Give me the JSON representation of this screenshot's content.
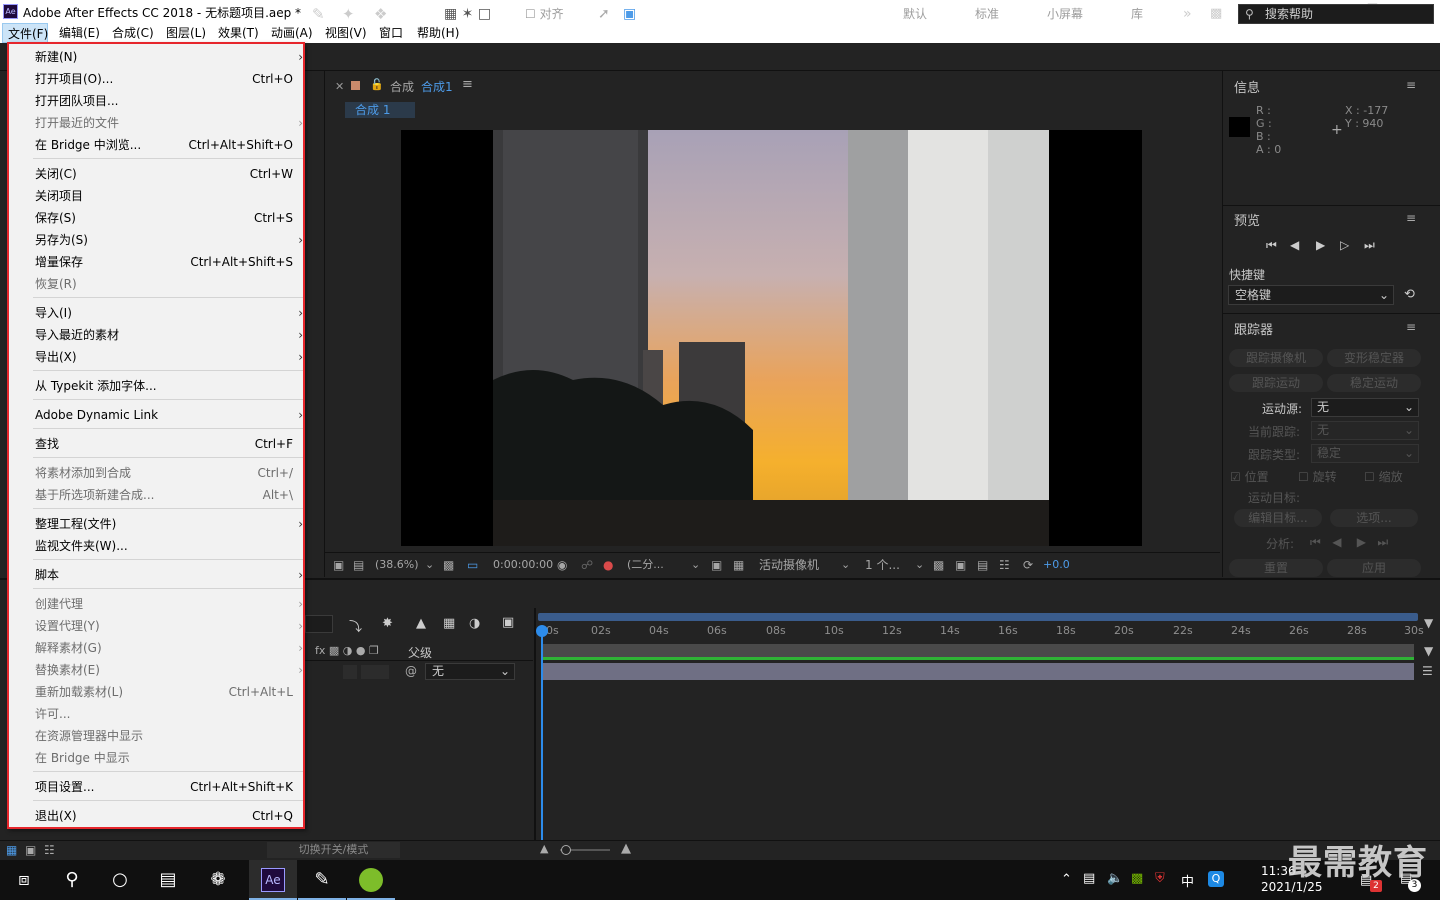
{
  "window": {
    "title": "Adobe After Effects CC 2018 - 无标题项目.aep *",
    "app_icon": "Ae"
  },
  "menubar": [
    "文件(F)",
    "编辑(E)",
    "合成(C)",
    "图层(L)",
    "效果(T)",
    "动画(A)",
    "视图(V)",
    "窗口",
    "帮助(H)"
  ],
  "toolbar": {
    "snap_label": "对齐",
    "workspaces": [
      "默认",
      "标准",
      "小屏幕",
      "库"
    ],
    "more": "»",
    "help_placeholder": "搜索帮助"
  },
  "file_menu": [
    {
      "label": "新建(N)",
      "shortcut": "",
      "submenu": true,
      "disabled": false
    },
    {
      "label": "打开项目(O)...",
      "shortcut": "Ctrl+O",
      "submenu": false,
      "disabled": false
    },
    {
      "label": "打开团队项目...",
      "shortcut": "",
      "submenu": false,
      "disabled": false
    },
    {
      "label": "打开最近的文件",
      "shortcut": "",
      "submenu": true,
      "disabled": true
    },
    {
      "label": "在 Bridge 中浏览...",
      "shortcut": "Ctrl+Alt+Shift+O",
      "submenu": false,
      "disabled": false
    },
    {
      "label": "关闭(C)",
      "shortcut": "Ctrl+W",
      "submenu": false,
      "disabled": false
    },
    {
      "label": "关闭项目",
      "shortcut": "",
      "submenu": false,
      "disabled": false
    },
    {
      "label": "保存(S)",
      "shortcut": "Ctrl+S",
      "submenu": false,
      "disabled": false
    },
    {
      "label": "另存为(S)",
      "shortcut": "",
      "submenu": true,
      "disabled": false
    },
    {
      "label": "增量保存",
      "shortcut": "Ctrl+Alt+Shift+S",
      "submenu": false,
      "disabled": false
    },
    {
      "label": "恢复(R)",
      "shortcut": "",
      "submenu": false,
      "disabled": true
    },
    {
      "label": "导入(I)",
      "shortcut": "",
      "submenu": true,
      "disabled": false
    },
    {
      "label": "导入最近的素材",
      "shortcut": "",
      "submenu": true,
      "disabled": false
    },
    {
      "label": "导出(X)",
      "shortcut": "",
      "submenu": true,
      "disabled": false
    },
    {
      "label": "从 Typekit 添加字体...",
      "shortcut": "",
      "submenu": false,
      "disabled": false
    },
    {
      "label": "Adobe Dynamic Link",
      "shortcut": "",
      "submenu": true,
      "disabled": false
    },
    {
      "label": "查找",
      "shortcut": "Ctrl+F",
      "submenu": false,
      "disabled": false
    },
    {
      "label": "将素材添加到合成",
      "shortcut": "Ctrl+/",
      "submenu": false,
      "disabled": true
    },
    {
      "label": "基于所选项新建合成...",
      "shortcut": "Alt+\\",
      "submenu": false,
      "disabled": true
    },
    {
      "label": "整理工程(文件)",
      "shortcut": "",
      "submenu": true,
      "disabled": false
    },
    {
      "label": "监视文件夹(W)...",
      "shortcut": "",
      "submenu": false,
      "disabled": false
    },
    {
      "label": "脚本",
      "shortcut": "",
      "submenu": true,
      "disabled": false
    },
    {
      "label": "创建代理",
      "shortcut": "",
      "submenu": true,
      "disabled": true
    },
    {
      "label": "设置代理(Y)",
      "shortcut": "",
      "submenu": true,
      "disabled": true
    },
    {
      "label": "解释素材(G)",
      "shortcut": "",
      "submenu": true,
      "disabled": true
    },
    {
      "label": "替换素材(E)",
      "shortcut": "",
      "submenu": true,
      "disabled": true
    },
    {
      "label": "重新加载素材(L)",
      "shortcut": "Ctrl+Alt+L",
      "submenu": false,
      "disabled": true
    },
    {
      "label": "许可...",
      "shortcut": "",
      "submenu": false,
      "disabled": true
    },
    {
      "label": "在资源管理器中显示",
      "shortcut": "",
      "submenu": false,
      "disabled": true
    },
    {
      "label": "在 Bridge 中显示",
      "shortcut": "",
      "submenu": false,
      "disabled": true
    },
    {
      "label": "项目设置...",
      "shortcut": "Ctrl+Alt+Shift+K",
      "submenu": false,
      "disabled": false
    },
    {
      "label": "退出(X)",
      "shortcut": "Ctrl+Q",
      "submenu": false,
      "disabled": false
    }
  ],
  "comp_panel": {
    "tab_prefix": "合成",
    "tab_name": "合成1",
    "subtab": "合成 1",
    "footer": {
      "zoom": "(38.6%)",
      "timecode": "0:00:00:00",
      "resolution": "(二分...",
      "camera": "活动摄像机",
      "views": "1 个...",
      "exposure": "+0.0"
    }
  },
  "info_panel": {
    "title": "信息",
    "r": "R :",
    "g": "G :",
    "b": "B :",
    "a": "A : 0",
    "x": "X : -177",
    "y": "Y : 940"
  },
  "preview_panel": {
    "title": "预览",
    "shortcut_label": "快捷键",
    "shortcut_value": "空格键"
  },
  "tracker_panel": {
    "title": "跟踪器",
    "btn_track_camera": "跟踪摄像机",
    "btn_warp_stabilizer": "变形稳定器",
    "btn_track_motion": "跟踪运动",
    "btn_stabilize_motion": "稳定运动",
    "motion_source_label": "运动源:",
    "motion_source_value": "无",
    "current_track_label": "当前跟踪:",
    "current_track_value": "无",
    "track_type_label": "跟踪类型:",
    "track_type_value": "稳定",
    "cb_position": "位置",
    "cb_rotation": "旋转",
    "cb_scale": "缩放",
    "motion_target_label": "运动目标:",
    "btn_edit_target": "编辑目标...",
    "btn_options": "选项...",
    "analyze_label": "分析:",
    "btn_reset": "重置",
    "btn_apply": "应用"
  },
  "timeline": {
    "parent_label": "父级",
    "parent_value": "无",
    "ticks": [
      "0s",
      "02s",
      "04s",
      "06s",
      "08s",
      "10s",
      "12s",
      "14s",
      "16s",
      "18s",
      "20s",
      "22s",
      "24s",
      "26s",
      "28s",
      "30s"
    ],
    "switches_label": "切换开关/模式"
  },
  "taskbar": {
    "time": "11:36",
    "date": "2021/1/25",
    "ime": "中",
    "notification_count": "3",
    "badge": "2"
  },
  "watermark": "最需教育"
}
